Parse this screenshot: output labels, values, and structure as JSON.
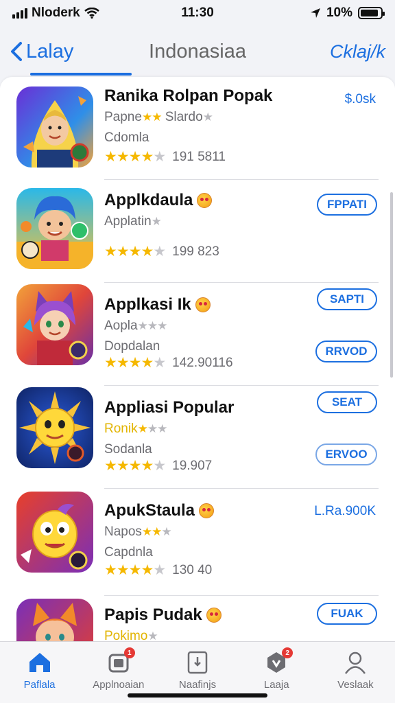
{
  "status": {
    "carrier": "Nloderk",
    "time": "11:30",
    "battery": "10%",
    "battery_level": 0.9
  },
  "nav": {
    "back_label": "Lalay",
    "title": "Indonasiaa",
    "right_label": "Cklaj/k"
  },
  "apps": [
    {
      "name": "Ranika Rolpan Popak",
      "sub1": "Papne",
      "sub1_extra": "Slardo",
      "sub2": "Cdomla",
      "rating_count": "191 5811",
      "action_text": "$.0sk"
    },
    {
      "name": "Applkdaula",
      "sub1": "Applatin",
      "rating_count": "199 823",
      "action_primary": "FPPATI"
    },
    {
      "name": "Applkasi Ik",
      "sub1": "Aopla",
      "sub2": "Dopdalan",
      "rating_count": "142.90116",
      "action_primary": "SAPTI",
      "action_secondary": "RRVOD"
    },
    {
      "name": "Appliasi Popular",
      "sub1": "Ronik",
      "sub2": "Sodanla",
      "rating_count": "19.907",
      "action_primary": "SEAT",
      "action_secondary": "ERVOO"
    },
    {
      "name": "ApukStaula",
      "sub1": "Napos",
      "sub2": "Capdnla",
      "rating_count": "130 40",
      "action_text": "L.Ra.900K"
    },
    {
      "name": "Papis Pudak",
      "sub1": "Pokimo",
      "action_primary": "FUAK"
    }
  ],
  "tabs": [
    {
      "label": "Paflala",
      "icon": "home-icon",
      "active": true
    },
    {
      "label": "Applnoaian",
      "icon": "apps-icon",
      "badge": "1"
    },
    {
      "label": "Naafinjs",
      "icon": "updates-icon"
    },
    {
      "label": "Laaja",
      "icon": "games-icon",
      "badge": "2"
    },
    {
      "label": "Veslaak",
      "icon": "profile-icon"
    }
  ],
  "colors": {
    "accent": "#1c6fe0",
    "star": "#f5b800",
    "badge": "#e53935"
  }
}
